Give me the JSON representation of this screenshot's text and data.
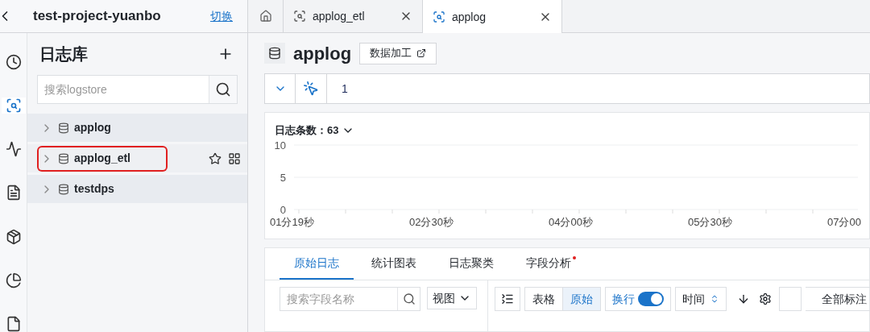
{
  "project": {
    "title": "test-project-yuanbo",
    "switch_link": "切换"
  },
  "rail": [
    {
      "kind": "clock",
      "selected": false
    },
    {
      "kind": "search",
      "selected": true
    },
    {
      "kind": "chart",
      "selected": false
    },
    {
      "kind": "list",
      "selected": false
    },
    {
      "kind": "box",
      "selected": false
    },
    {
      "kind": "pie",
      "selected": false
    },
    {
      "kind": "doc",
      "selected": false
    }
  ],
  "tabs": [
    {
      "kind": "home",
      "selected": false
    },
    {
      "kind": "page",
      "label": "applog_etl",
      "selected": false
    },
    {
      "kind": "page",
      "label": "applog",
      "selected": true
    }
  ],
  "sidebar": {
    "title": "日志库",
    "search": {
      "placeholder": "搜索logstore"
    },
    "items": [
      {
        "name": "applog",
        "expanded": false,
        "hovered": false,
        "highlighted": false
      },
      {
        "name": "applog_etl",
        "expanded": false,
        "hovered": true,
        "highlighted": true
      },
      {
        "name": "testdps",
        "expanded": false,
        "hovered": false,
        "highlighted": false
      }
    ]
  },
  "header": {
    "title": "applog",
    "button": "数据加工"
  },
  "query": {
    "value": "1"
  },
  "histogram": {
    "title": "日志条数：63",
    "chart_data": {
      "type": "bar",
      "categories": [
        "01分19秒",
        "02分30秒",
        "04分00秒",
        "05分30秒",
        "07分00"
      ],
      "values": [
        null,
        null,
        null,
        null,
        null
      ],
      "ylim": [
        0,
        10
      ],
      "yticks": [
        0,
        5,
        10
      ]
    }
  },
  "result_tabs": [
    {
      "label": "原始日志",
      "selected": true,
      "dot": false
    },
    {
      "label": "统计图表",
      "selected": false,
      "dot": false
    },
    {
      "label": "日志聚类",
      "selected": false,
      "dot": false
    },
    {
      "label": "字段分析",
      "selected": false,
      "dot": true
    }
  ],
  "field_search": {
    "placeholder": "搜索字段名称"
  },
  "view_select": "视图",
  "view_modes": [
    {
      "label": "表格",
      "selected": false
    },
    {
      "label": "原始",
      "selected": true
    }
  ],
  "wrap": {
    "label": "换行",
    "on": true
  },
  "sort": "时间",
  "mark_all": "全部标注"
}
